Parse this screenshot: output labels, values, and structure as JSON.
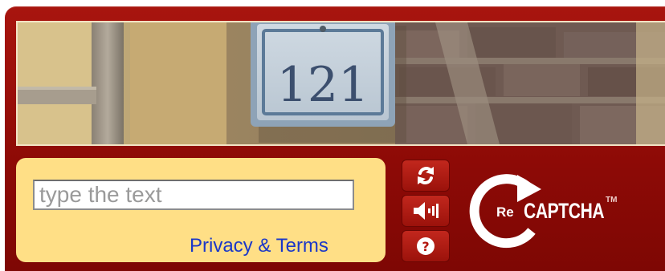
{
  "widget": {
    "challenge_image": {
      "alt_text": "121"
    },
    "input": {
      "placeholder": "type the text",
      "value": ""
    },
    "privacy_link": "Privacy & Terms",
    "controls": [
      {
        "icon": "reload-icon"
      },
      {
        "icon": "audio-icon"
      },
      {
        "icon": "help-icon"
      }
    ],
    "logo": {
      "prefix": "Re",
      "name": "CAPTCHA",
      "trademark": "TM"
    },
    "colors": {
      "frame": "#9a0f09",
      "panel": "#ffdf86",
      "link": "#1a37c9"
    }
  }
}
